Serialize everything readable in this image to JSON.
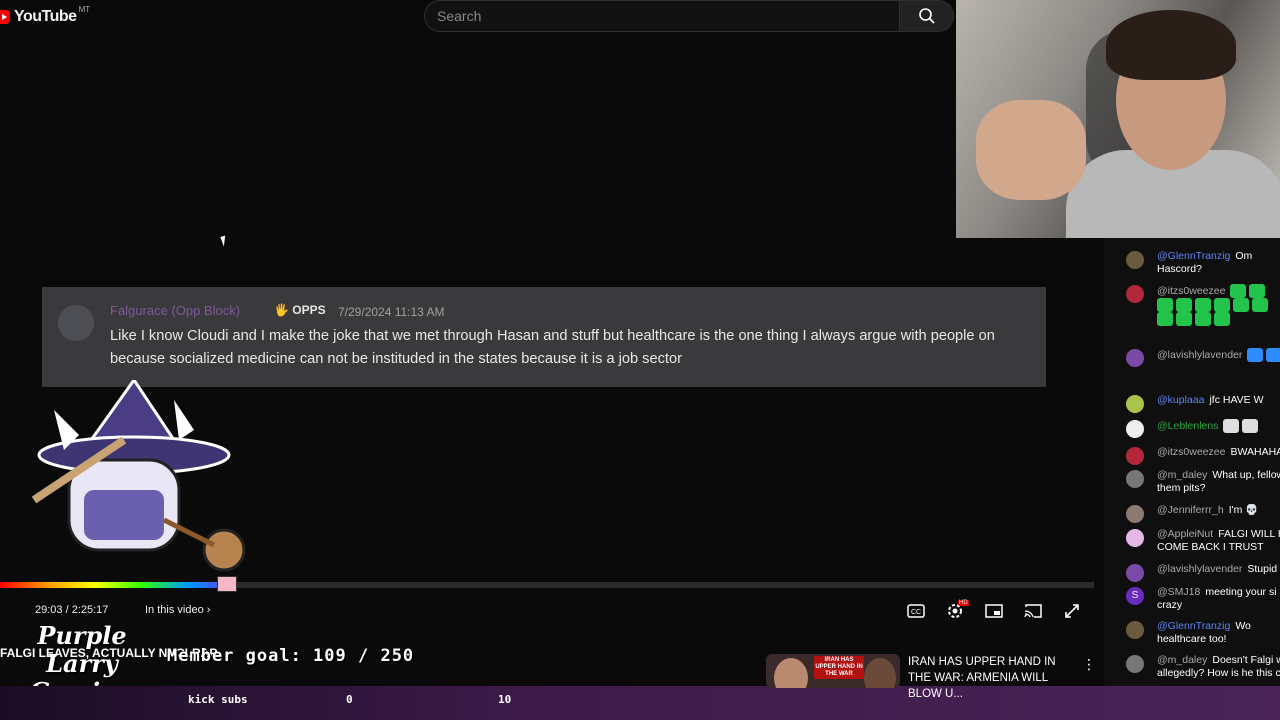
{
  "header": {
    "logo_text": "YouTube",
    "logo_region": "MT",
    "search_placeholder": "Search"
  },
  "message": {
    "author": "Falgurace (Opp Block)",
    "role_tag": "OPPS",
    "timestamp": "7/29/2024 11:13 AM",
    "text": "Like I know Cloudi and I make the joke that we met through Hasan and stuff but healthcare is the one thing I always argue with people on because socialized medicine can not be instituded in the states because it is a job sector"
  },
  "player": {
    "progress_fraction": 0.215,
    "time": "29:03 / 2:25:17",
    "chapter": "In this video",
    "settings_badge": "HD"
  },
  "overlay": {
    "logo_lines": [
      "Purple",
      "Larry",
      "Gaming"
    ],
    "ticker": "FALGI LEAVES, ACTUALLY NHCLRAP",
    "member_goal": "Member goal: 109 / 250",
    "kick_label": "kick subs",
    "kick_current": "0",
    "kick_target": "10"
  },
  "endcard": {
    "thumb_badge": "IRAN HAS UPPER HAND IN THE WAR",
    "title": "IRAN HAS UPPER HAND IN THE WAR: ARMENIA WILL BLOW U...",
    "more_icon": "more-vert-icon"
  },
  "chat": [
    {
      "user": "@GlennTranzig",
      "style": "blue",
      "text": "Om",
      "text2": "Hascord?",
      "avatar_color": "#6b5b3e"
    },
    {
      "user": "@itzs0weezee",
      "style": "",
      "text": "",
      "emotes": 12,
      "avatar_color": "#b0283a"
    },
    {
      "user": "@lavishlylavender",
      "style": "",
      "text": "",
      "emotes": 2,
      "emote_style": "blue",
      "avatar_color": "#7b4aa8"
    },
    {
      "user": "@kuplaaa",
      "style": "blue",
      "text": "jfc HAVE W",
      "avatar_color": "#a8c44a"
    },
    {
      "user": "@Leblenlens",
      "style": "green",
      "text": "",
      "emotes": 2,
      "emote_style": "white",
      "avatar_color": "#eeeeee"
    },
    {
      "user": "@itzs0weezee",
      "style": "",
      "text": "BWAHAHA",
      "avatar_color": "#b0283a"
    },
    {
      "user": "@m_daley",
      "style": "",
      "text": "What up, fellow",
      "text2": "them pits?",
      "avatar_color": "#777777"
    },
    {
      "user": "@Jenniferrr_h",
      "style": "",
      "text": "I'm 💀",
      "avatar_color": "#8a7a70"
    },
    {
      "user": "@AppleiNut",
      "style": "",
      "text": "FALGI WILL H",
      "text2": "COME BACK I TRUST",
      "avatar_color": "#e6b8e8"
    },
    {
      "user": "@lavishlylavender",
      "style": "",
      "text": "Stupid",
      "avatar_color": "#7b4aa8"
    },
    {
      "user": "@SMJ18",
      "style": "",
      "text": "meeting your si",
      "text2": "crazy",
      "avatar_color": "#6a2bbf",
      "initial": "S"
    },
    {
      "user": "@GlennTranzig",
      "style": "blue",
      "text": "Wo",
      "text2": "healthcare too!",
      "avatar_color": "#6b5b3e"
    },
    {
      "user": "@m_daley",
      "style": "",
      "text": "Doesn't Falgi w",
      "text2": "allegedly? How is he this c",
      "avatar_color": "#777777"
    }
  ]
}
